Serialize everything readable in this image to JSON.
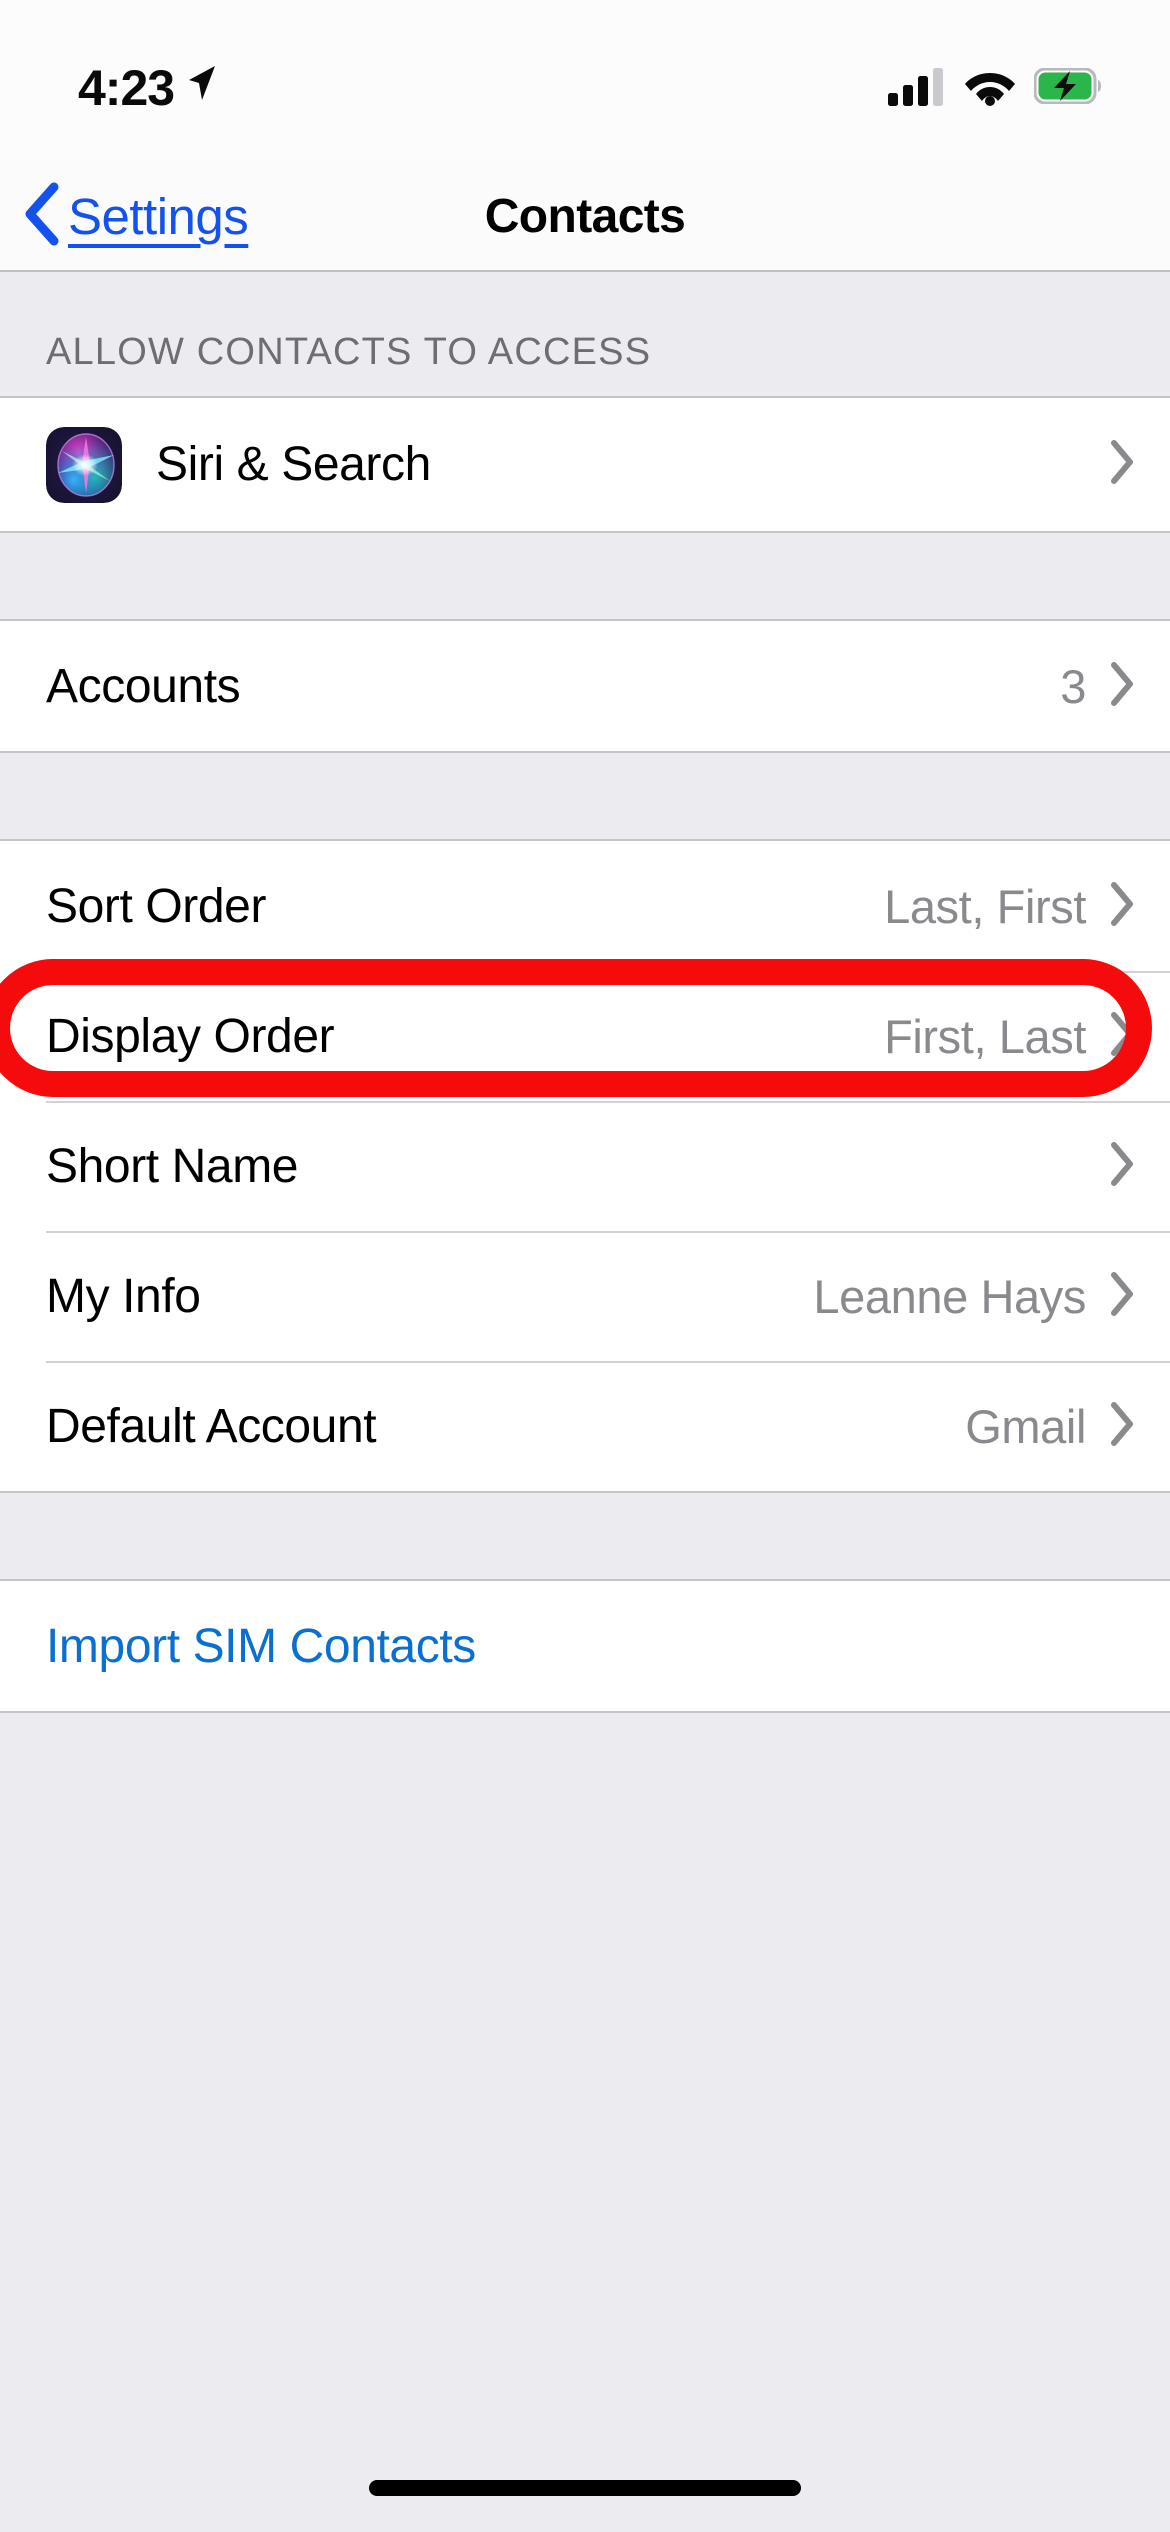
{
  "status_bar": {
    "time": "4:23",
    "location_icon": "location-arrow-icon",
    "cellular_icon": "cellular-signal-icon",
    "wifi_icon": "wifi-icon",
    "battery_icon": "battery-charging-icon",
    "battery_color": "#34c759",
    "signal_bars": 3,
    "signal_bars_total": 4
  },
  "nav": {
    "back_label": "Settings",
    "back_icon": "chevron-left-icon",
    "title": "Contacts",
    "tint_color": "#1452ed"
  },
  "sections": [
    {
      "header": "ALLOW CONTACTS TO ACCESS",
      "rows": [
        {
          "label": "Siri & Search",
          "value": "",
          "icon": "siri-icon",
          "chevron": true
        }
      ]
    },
    {
      "header": "",
      "rows": [
        {
          "label": "Accounts",
          "value": "3",
          "icon": "",
          "chevron": true
        }
      ]
    },
    {
      "header": "",
      "rows": [
        {
          "label": "Sort Order",
          "value": "Last, First",
          "icon": "",
          "chevron": true
        },
        {
          "label": "Display Order",
          "value": "First, Last",
          "icon": "",
          "chevron": true
        },
        {
          "label": "Short Name",
          "value": "",
          "icon": "",
          "chevron": true
        },
        {
          "label": "My Info",
          "value": "Leanne Hays",
          "icon": "",
          "chevron": true
        },
        {
          "label": "Default Account",
          "value": "Gmail",
          "icon": "",
          "chevron": true
        }
      ]
    },
    {
      "header": "",
      "rows": [
        {
          "label": "Import SIM Contacts",
          "value": "",
          "icon": "",
          "chevron": false,
          "is_link": true
        }
      ]
    }
  ],
  "annotation": {
    "type": "highlight-oval",
    "color": "#f50b0b",
    "target_row_label": "Display Order"
  },
  "home_indicator": "home-indicator-bar"
}
